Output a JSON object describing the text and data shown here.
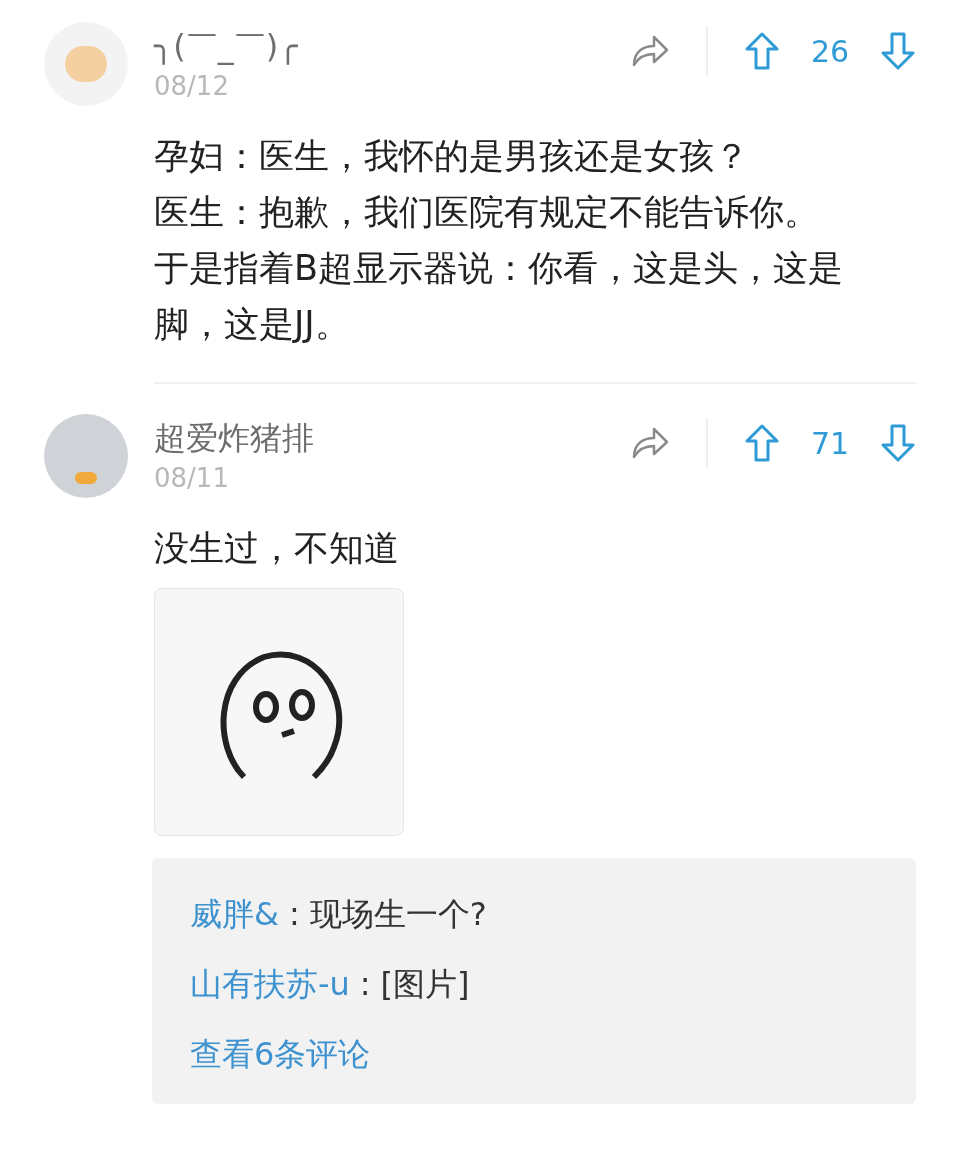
{
  "comments": [
    {
      "username": "╮(￣_￣)╭",
      "date": "08/12",
      "votes": "26",
      "paragraphs": [
        "孕妇：医生，我怀的是男孩还是女孩？",
        "医生：抱歉，我们医院有规定不能告诉你。",
        "于是指着B超显示器说：你看，这是头，这是脚，这是JJ。"
      ]
    },
    {
      "username": "超爱炸猪排",
      "date": "08/11",
      "votes": "71",
      "paragraphs": [
        "没生过，不知道"
      ],
      "image": {
        "kind": "meme"
      },
      "replies": [
        {
          "name": "威胖&",
          "separator": ":",
          "text": "现场生一个?"
        },
        {
          "name": "山有扶苏-u",
          "separator": ":",
          "text": "[图片]"
        }
      ],
      "more_replies": "查看6条评论"
    }
  ]
}
